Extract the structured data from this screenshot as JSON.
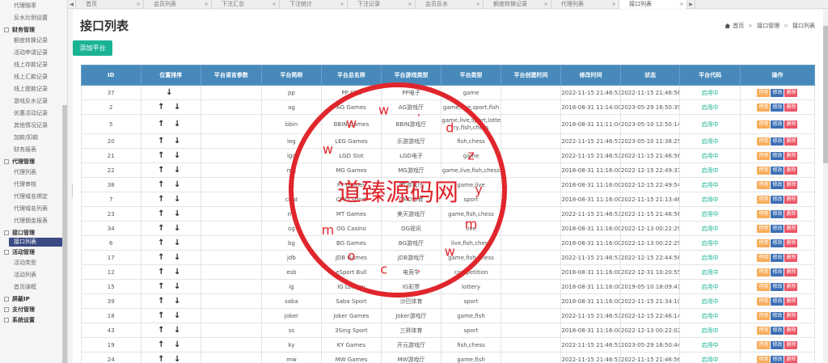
{
  "sidebar": {
    "items": [
      {
        "type": "item",
        "label": "代理赔率"
      },
      {
        "type": "item",
        "label": "反水比例设置"
      },
      {
        "type": "group",
        "label": "财务管理"
      },
      {
        "type": "item",
        "label": "额度转换记录"
      },
      {
        "type": "item",
        "label": "活动申请记录"
      },
      {
        "type": "item",
        "label": "线上存款记录"
      },
      {
        "type": "item",
        "label": "线上汇款记录"
      },
      {
        "type": "item",
        "label": "线上提款记录"
      },
      {
        "type": "item",
        "label": "游戏反水记录"
      },
      {
        "type": "item",
        "label": "优惠活动记录"
      },
      {
        "type": "item",
        "label": "其他情况记录"
      },
      {
        "type": "item",
        "label": "加款/扣款"
      },
      {
        "type": "item",
        "label": "财务报表"
      },
      {
        "type": "group",
        "label": "代理管理"
      },
      {
        "type": "item",
        "label": "代理列表"
      },
      {
        "type": "item",
        "label": "代理审核"
      },
      {
        "type": "item",
        "label": "代理域名绑定"
      },
      {
        "type": "item",
        "label": "代理域名列表"
      },
      {
        "type": "item",
        "label": "代理佣金报表"
      },
      {
        "type": "group",
        "label": "接口管理"
      },
      {
        "type": "item",
        "label": "接口列表",
        "active": true
      },
      {
        "type": "group",
        "label": "活动管理"
      },
      {
        "type": "item",
        "label": "活动类型"
      },
      {
        "type": "item",
        "label": "活动列表"
      },
      {
        "type": "item",
        "label": "首页弹框"
      },
      {
        "type": "group",
        "label": "屏蔽IP"
      },
      {
        "type": "group",
        "label": "支付管理"
      },
      {
        "type": "group",
        "label": "系统设置"
      }
    ]
  },
  "tabs": [
    {
      "label": "首页",
      "active": false
    },
    {
      "label": "会员列表",
      "active": false
    },
    {
      "label": "下注汇总",
      "active": false
    },
    {
      "label": "下注统计",
      "active": false
    },
    {
      "label": "下注记录",
      "active": false
    },
    {
      "label": "会员反水",
      "active": false
    },
    {
      "label": "额度转换记录",
      "active": false
    },
    {
      "label": "代理列表",
      "active": false
    },
    {
      "label": "接口列表",
      "active": true
    }
  ],
  "tab_controls": {
    "left": "◀",
    "right": "▶",
    "close": "×"
  },
  "page": {
    "title": "接口列表",
    "breadcrumb": {
      "home": "首页",
      "parent": "接口管理",
      "current": "接口列表"
    },
    "add_button": "添加平台"
  },
  "table": {
    "columns": [
      "ID",
      "位置排序",
      "平台语言参数",
      "平台简称",
      "平台总名称",
      "平台游戏类型",
      "平台类型",
      "平台创建时间",
      "修改时间",
      "状态",
      "平台代码",
      "操作"
    ],
    "actions": {
      "stop": "停用",
      "edit": "修改",
      "delete": "删除"
    },
    "rows": [
      {
        "id": "37",
        "sort": "↓",
        "lang": "",
        "short": "pp",
        "name": "PP Slot",
        "game_type": "PP电子",
        "type": "game",
        "created": "",
        "modified": "2022-11-15 21:46:53",
        "status": "2022-11-15 21:46:56",
        "code": "启用中"
      },
      {
        "id": "2",
        "sort": "↑ ↓",
        "lang": "",
        "short": "ag",
        "name": "AG Games",
        "game_type": "AG游戏厅",
        "type": "game,live,sport,fish",
        "created": "",
        "modified": "2018-08-31 11:14:00",
        "status": "2023-05-29 16:50:39",
        "code": "启用中"
      },
      {
        "id": "5",
        "sort": "↑ ↓",
        "lang": "",
        "short": "bbin",
        "name": "BBIN Games",
        "game_type": "BBIN游戏厅",
        "type": "game,live,sport,lotte ry,fish,chess",
        "created": "",
        "modified": "2018-08-31 11:11:04",
        "status": "2023-05-10 12:50:14",
        "code": "启用中",
        "tall": true
      },
      {
        "id": "20",
        "sort": "↑ ↓",
        "lang": "",
        "short": "leg",
        "name": "LEG Games",
        "game_type": "乐游游戏厅",
        "type": "fish,chess",
        "created": "",
        "modified": "2022-11-15 21:46:53",
        "status": "2023-05-10 11:38:25",
        "code": "启用中"
      },
      {
        "id": "21",
        "sort": "↑ ↓",
        "lang": "",
        "short": "lgd",
        "name": "LGD Slot",
        "game_type": "LGD电子",
        "type": "game",
        "created": "",
        "modified": "2022-11-15 21:46:53",
        "status": "2022-11-15 21:46:56",
        "code": "启用中"
      },
      {
        "id": "22",
        "sort": "↑ ↓",
        "lang": "",
        "short": "mg",
        "name": "MG Games",
        "game_type": "MG游戏厅",
        "type": "game,live,fish,chess",
        "created": "",
        "modified": "2018-08-31 11:16:00",
        "status": "2022-12-15 22:49:37",
        "code": "启用中"
      },
      {
        "id": "38",
        "sort": "↑ ↓",
        "lang": "",
        "short": "pt",
        "name": "PT Games",
        "game_type": "PT游戏厅",
        "type": "game,live",
        "created": "",
        "modified": "2018-08-31 11:16:00",
        "status": "2022-12-15 22:49:54",
        "code": "启用中"
      },
      {
        "id": "7",
        "sort": "↑ ↓",
        "lang": "",
        "short": "cmd",
        "name": "CMD Sport",
        "game_type": "CMD体育",
        "type": "sport",
        "created": "",
        "modified": "2018-08-31 11:16:00",
        "status": "2022-11-15 21:13:46",
        "code": "启用中"
      },
      {
        "id": "23",
        "sort": "↑ ↓",
        "lang": "",
        "short": "mt",
        "name": "MT Games",
        "game_type": "美天游戏厅",
        "type": "game,fish,chess",
        "created": "",
        "modified": "2022-11-15 21:46:53",
        "status": "2022-11-15 21:46:56",
        "code": "启用中"
      },
      {
        "id": "34",
        "sort": "↑ ↓",
        "lang": "",
        "short": "og",
        "name": "OG Casino",
        "game_type": "OG视讯",
        "type": "live",
        "created": "",
        "modified": "2018-08-31 11:16:00",
        "status": "2022-12-13 00:22:29",
        "code": "启用中"
      },
      {
        "id": "6",
        "sort": "↑ ↓",
        "lang": "",
        "short": "bg",
        "name": "BG Games",
        "game_type": "BG游戏厅",
        "type": "live,fish,chess",
        "created": "",
        "modified": "2018-08-31 11:16:00",
        "status": "2022-12-13 00:22:29",
        "code": "启用中"
      },
      {
        "id": "17",
        "sort": "↑ ↓",
        "lang": "",
        "short": "jdb",
        "name": "JDB Games",
        "game_type": "JDB游戏厅",
        "type": "game,fish,chess",
        "created": "",
        "modified": "2022-11-15 21:46:53",
        "status": "2022-12-15 22:44:58",
        "code": "启用中"
      },
      {
        "id": "12",
        "sort": "↑ ↓",
        "lang": "",
        "short": "esb",
        "name": "eSport Bull",
        "game_type": "电竞牛",
        "type": "competition",
        "created": "",
        "modified": "2018-08-31 11:16:00",
        "status": "2022-12-31 10:20:55",
        "code": "启用中"
      },
      {
        "id": "15",
        "sort": "↑ ↓",
        "lang": "",
        "short": "ig",
        "name": "IG Lottery",
        "game_type": "IG彩票",
        "type": "lottery",
        "created": "",
        "modified": "2018-08-31 11:16:00",
        "status": "2019-05-10 18:09:41",
        "code": "启用中"
      },
      {
        "id": "39",
        "sort": "↑ ↓",
        "lang": "",
        "short": "saba",
        "name": "Saba Sport",
        "game_type": "沙巴体育",
        "type": "sport",
        "created": "",
        "modified": "2018-08-31 11:16:00",
        "status": "2022-11-15 21:34:10",
        "code": "启用中"
      },
      {
        "id": "18",
        "sort": "↑ ↓",
        "lang": "",
        "short": "joker",
        "name": "Joker Games",
        "game_type": "Joker游戏厅",
        "type": "game,fish",
        "created": "",
        "modified": "2022-11-15 21:46:53",
        "status": "2022-12-15 22:46:14",
        "code": "启用中"
      },
      {
        "id": "43",
        "sort": "↑ ↓",
        "lang": "",
        "short": "ss",
        "name": "3Sing Sport",
        "game_type": "三昇体育",
        "type": "sport",
        "created": "",
        "modified": "2018-08-31 11:16:00",
        "status": "2022-12-13 00:22:02",
        "code": "启用中"
      },
      {
        "id": "19",
        "sort": "↑ ↓",
        "lang": "",
        "short": "ky",
        "name": "KY Games",
        "game_type": "开元游戏厅",
        "type": "fish,chess",
        "created": "",
        "modified": "2022-11-15 21:46:53",
        "status": "2023-05-29 16:50:44",
        "code": "启用中"
      },
      {
        "id": "24",
        "sort": "↑ ↓",
        "lang": "",
        "short": "mw",
        "name": "MW Games",
        "game_type": "MW游戏厅",
        "type": "game,fish",
        "created": "",
        "modified": "2022-11-15 21:46:53",
        "status": "2022-11-15 21:46:56",
        "code": "启用中"
      }
    ]
  },
  "watermark": {
    "text": "道臻源码网",
    "url_text": "w w w . d z y m w . c o m",
    "color": "#e0262c"
  }
}
